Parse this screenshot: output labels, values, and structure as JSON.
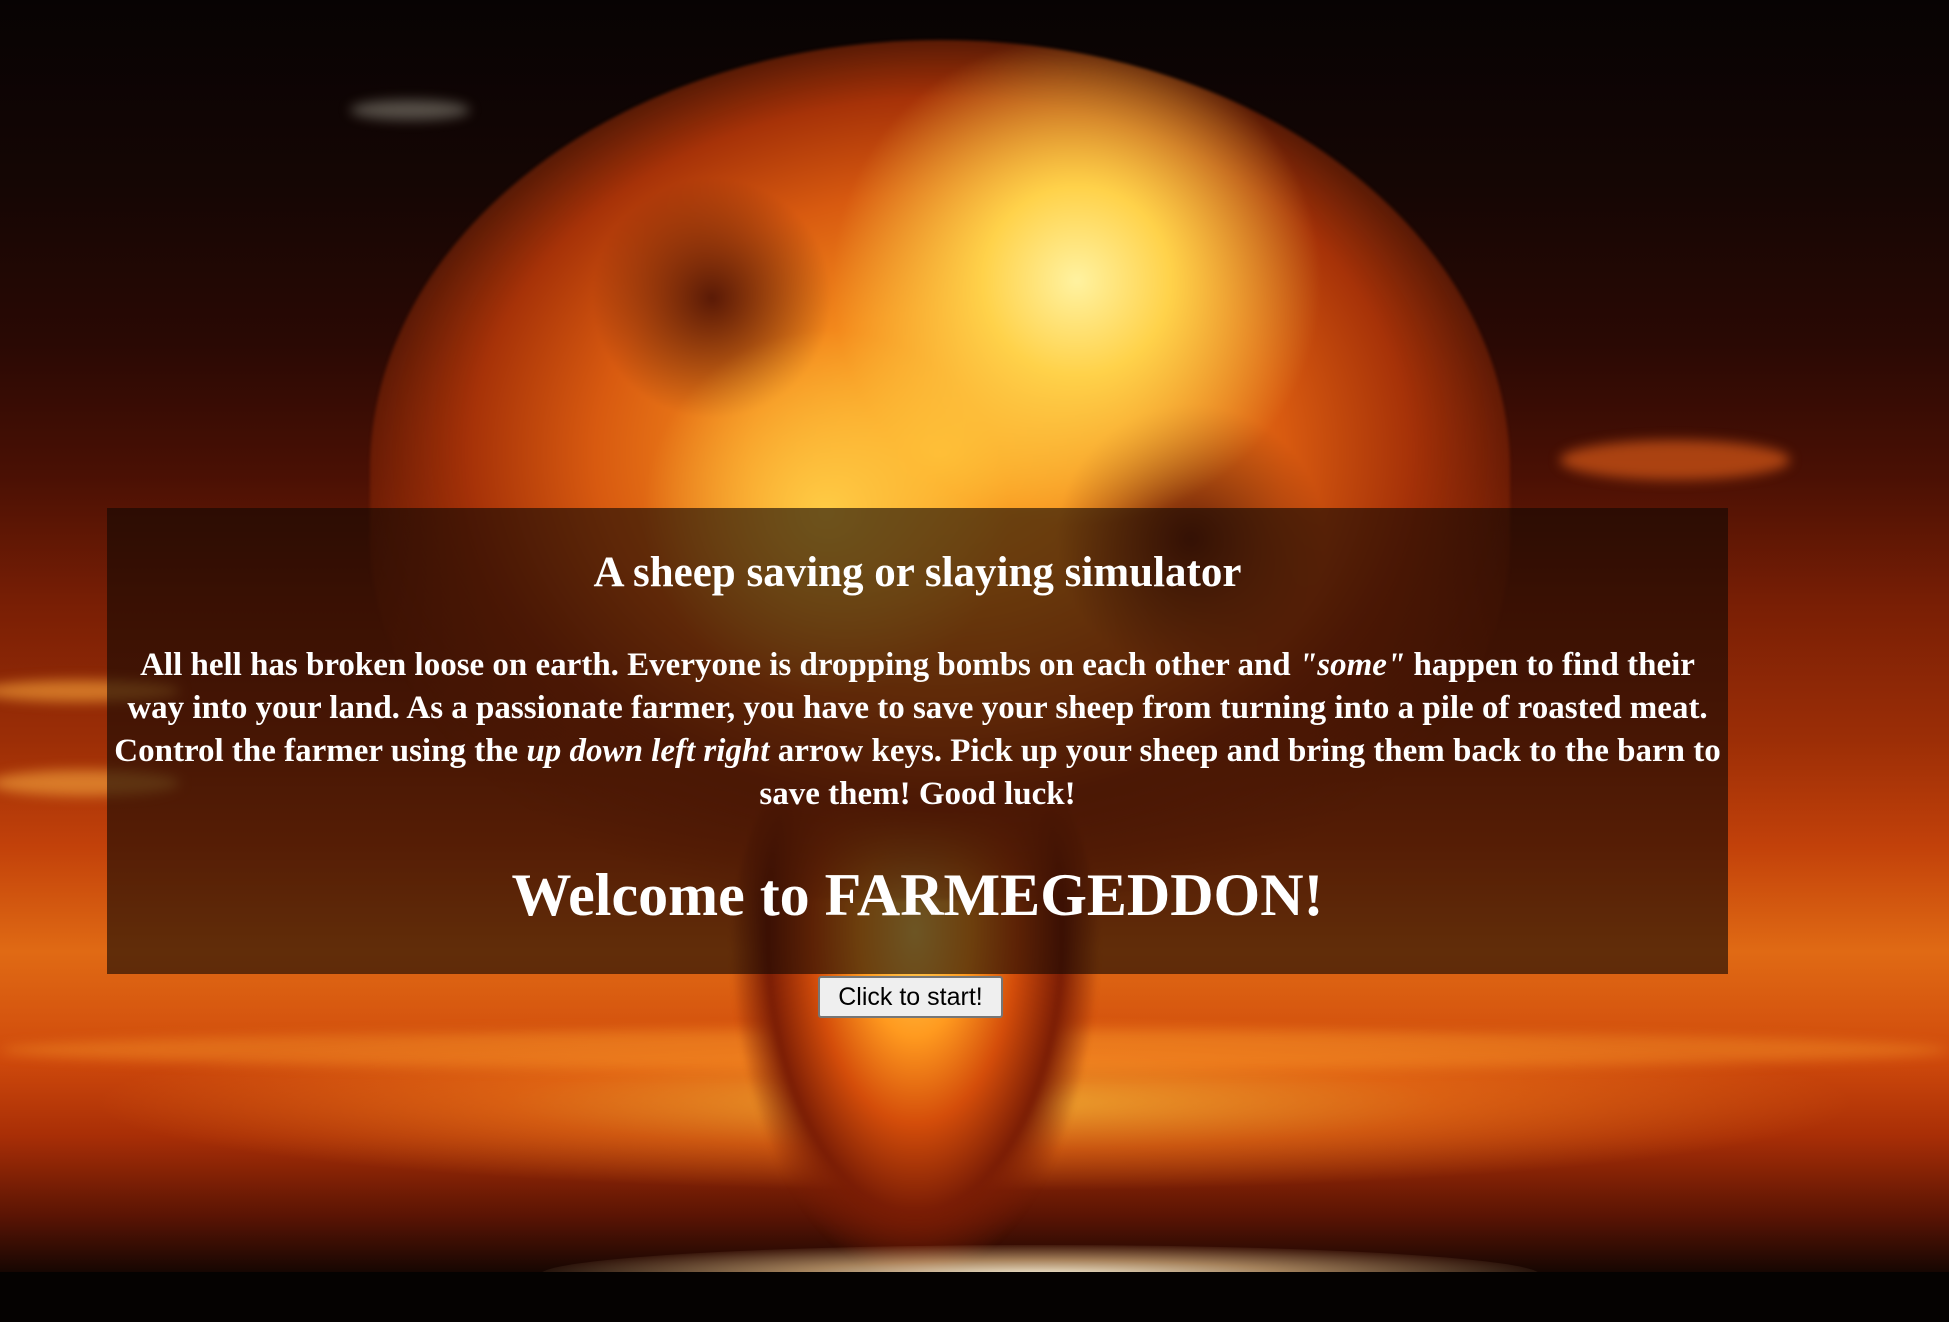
{
  "game": {
    "subtitle": "A sheep saving or slaying simulator",
    "description": {
      "part1": "All hell has broken loose on earth. Everyone is dropping bombs on each other and ",
      "emphasis1": "\"some\"",
      "part2": " happen to find their way into your land. As a passionate farmer, you have to save your sheep from turning into a pile of roasted meat. Control the farmer using the ",
      "emphasis2": "up down left right",
      "part3": " arrow keys. Pick up your sheep and bring them back to the barn to save them! Good luck!"
    },
    "welcome": "Welcome to FARMEGEDDON!",
    "start_button": "Click to start!"
  },
  "background": {
    "scene": "nuclear-explosion",
    "colors": {
      "fire": "#ff9a1f",
      "sky": "#2a0904",
      "panel": "#140804"
    }
  }
}
